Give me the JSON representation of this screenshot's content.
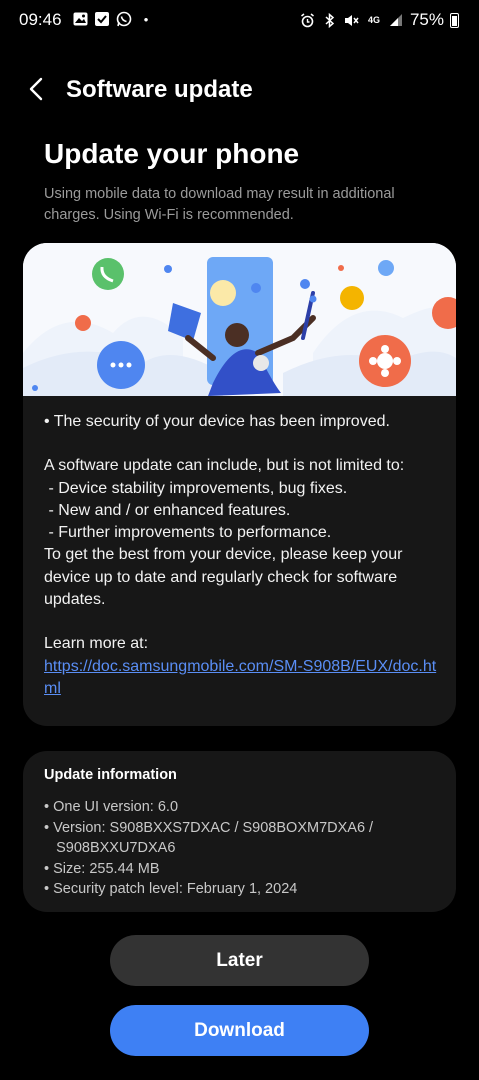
{
  "status_bar": {
    "time": "09:46",
    "battery_percent": "75%",
    "network": "4G",
    "dot": "•",
    "left_icons": [
      "gallery-icon",
      "checklist-icon",
      "whatsapp-icon"
    ],
    "right_icons": [
      "alarm-icon",
      "bluetooth-icon",
      "mute-icon",
      "4g-icon",
      "signal-icon",
      "battery-icon"
    ]
  },
  "header": {
    "back_icon": "chevron-left-icon",
    "title": "Software update"
  },
  "main": {
    "title": "Update your phone",
    "notice": "Using mobile data to download may result in additional charges. Using Wi-Fi is recommended."
  },
  "release_notes": {
    "security_line": "• The security of your device has been improved.",
    "intro": "A software update can include, but is not limited to:",
    "items": [
      " - Device stability improvements, bug fixes.",
      " - New and / or enhanced features.",
      " - Further improvements to performance."
    ],
    "advice": "To get the best from your device, please keep your device up to date and regularly check for software updates.",
    "learn_more_label": "Learn more at:",
    "learn_more_url": "https://doc.samsungmobile.com/SM-S908B/EUX/doc.html"
  },
  "update_info": {
    "title": "Update information",
    "lines": [
      "• One UI version: 6.0",
      "• Version: S908BXXS7DXAC / S908BOXM7DXA6 /",
      "   S908BXXU7DXA6",
      "• Size: 255.44 MB",
      "• Security patch level: February 1, 2024"
    ]
  },
  "buttons": {
    "later": "Later",
    "download": "Download"
  },
  "colors": {
    "background": "#000000",
    "card": "#171717",
    "accent": "#3e80f4",
    "link": "#5a8ef5",
    "secondary_button": "#333333"
  }
}
